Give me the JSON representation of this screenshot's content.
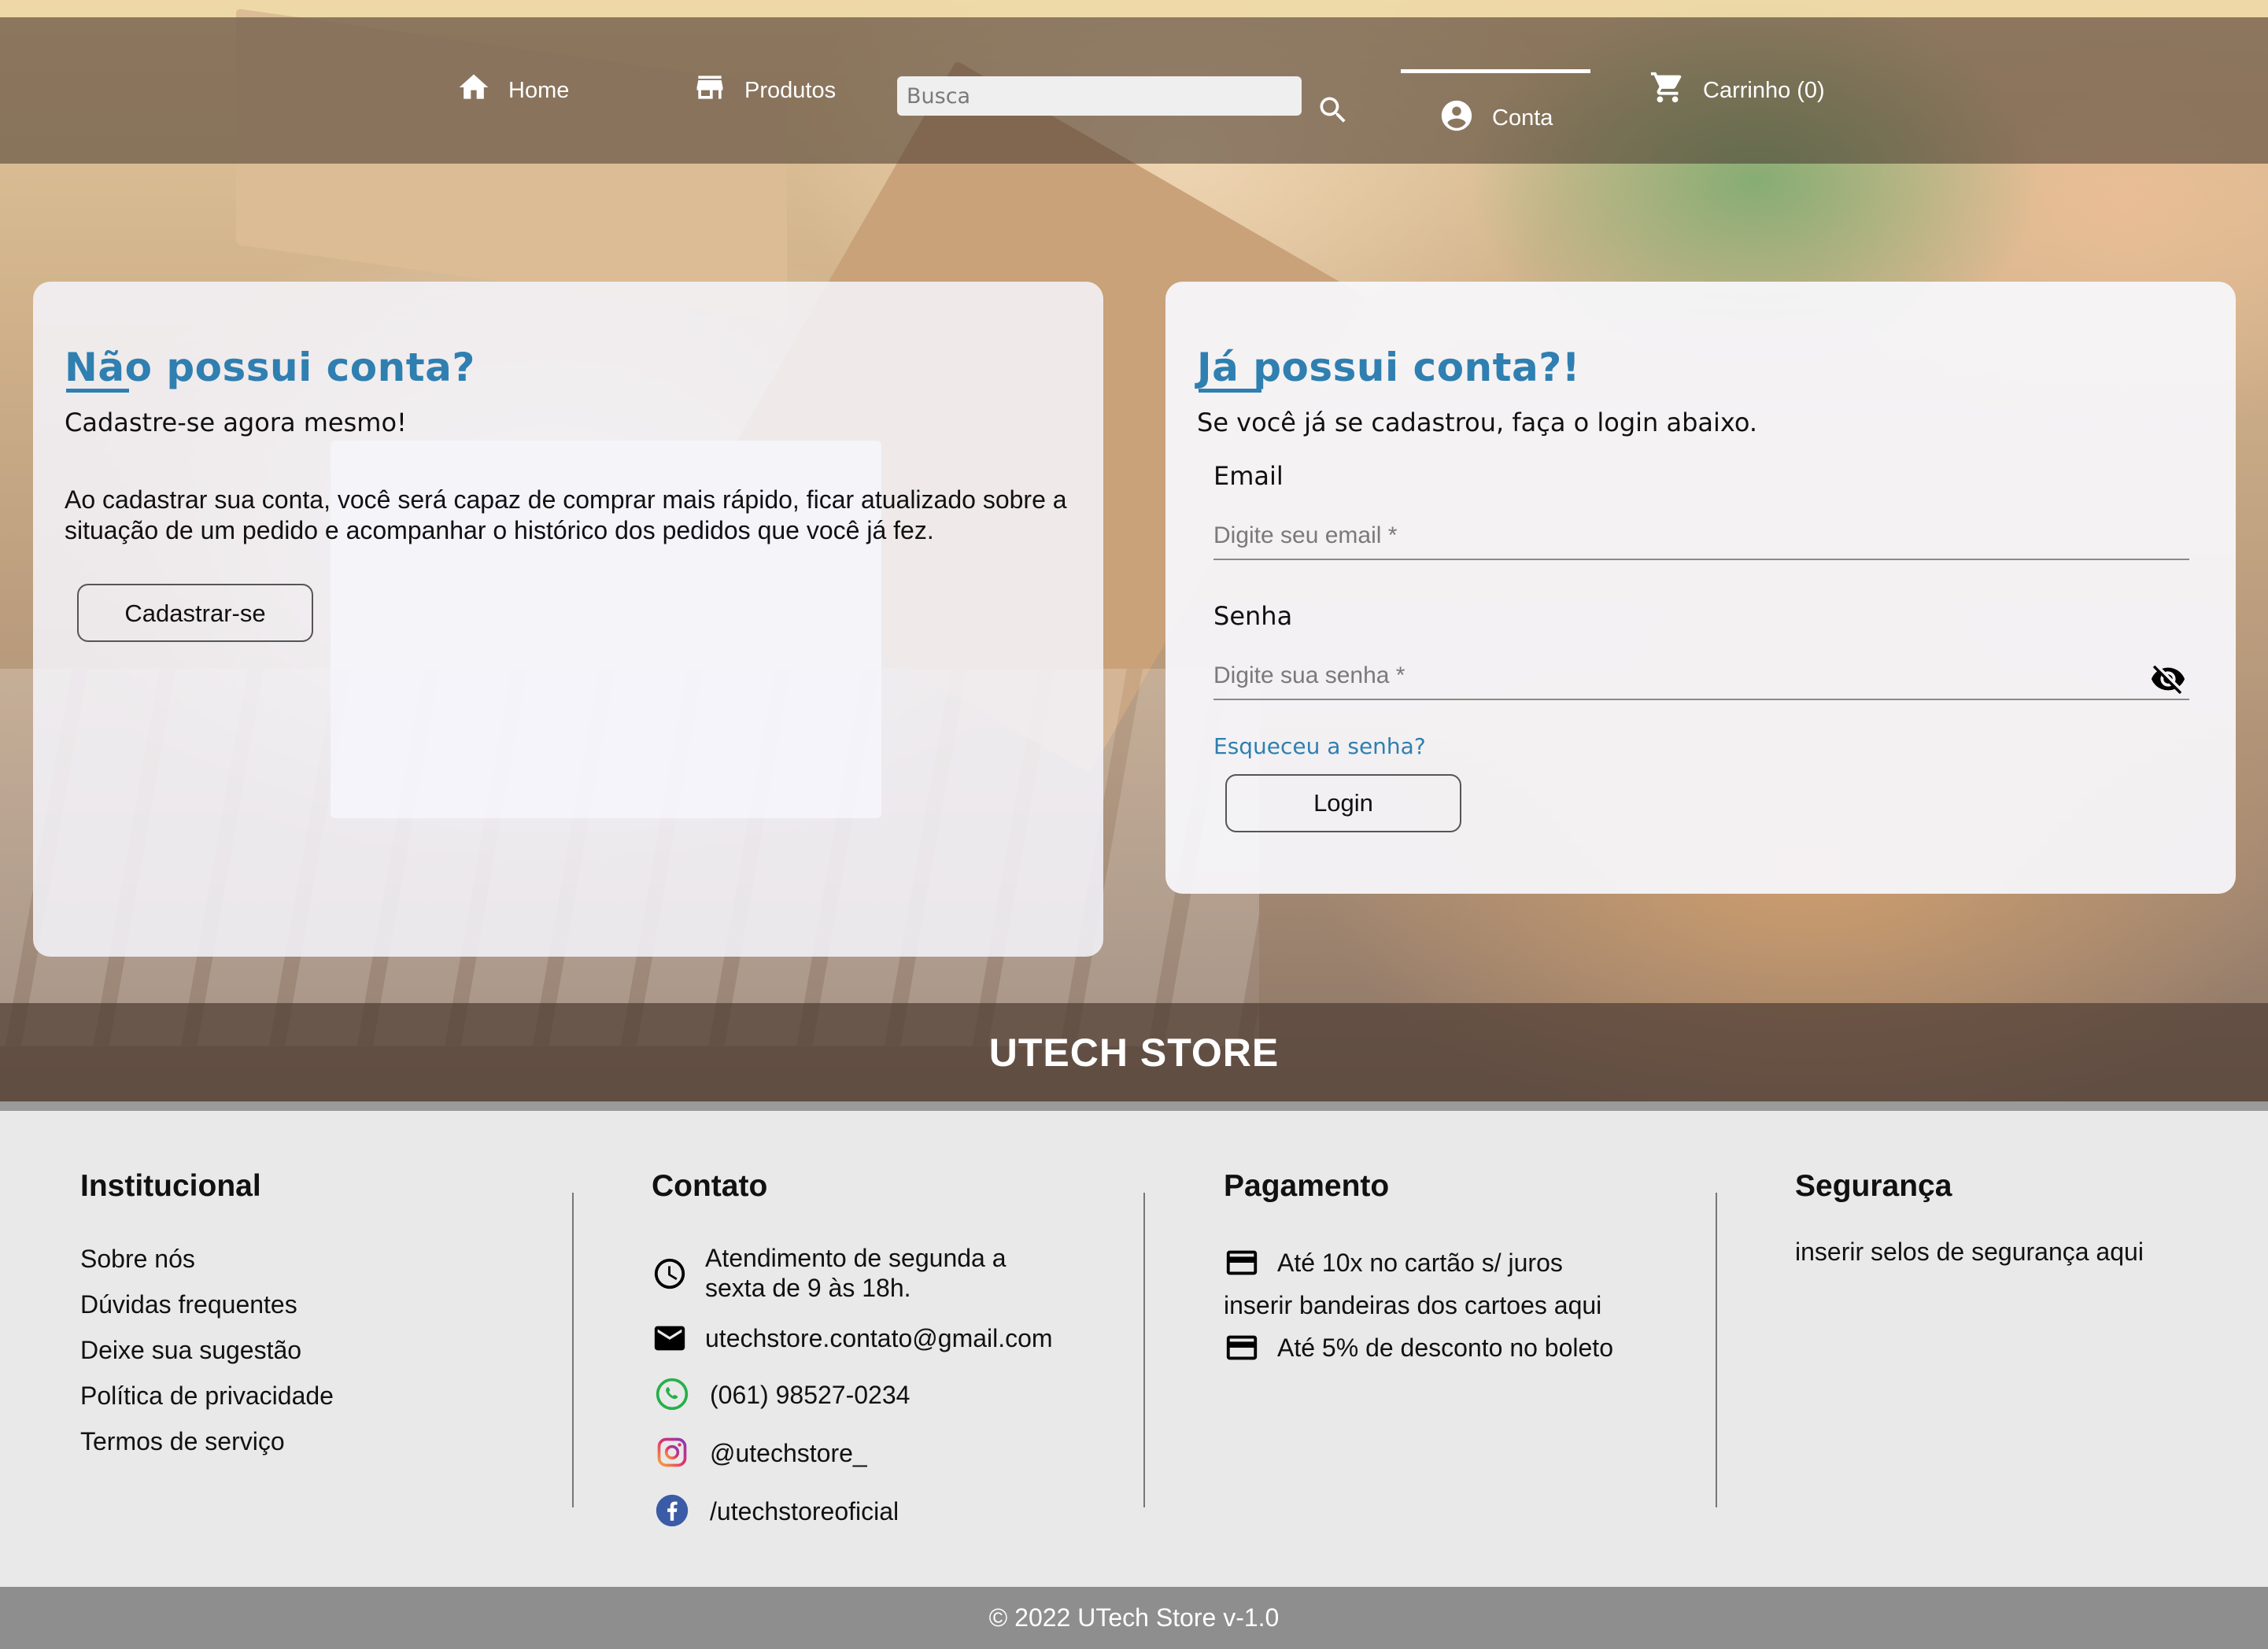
{
  "colors": {
    "accent": "#2f7fb1",
    "footer_bg": "#e9e9e9",
    "copyright_bg": "#8e8e8e"
  },
  "nav": {
    "home": "Home",
    "produtos": "Produtos",
    "search_placeholder": "Busca",
    "conta": "Conta",
    "carrinho": "Carrinho (0)"
  },
  "register": {
    "title": "Não possui conta?",
    "subtitle": "Cadastre-se agora mesmo!",
    "description": "Ao cadastrar sua conta, você será capaz de comprar mais rápido, ficar atualizado sobre a situação de um pedido e acompanhar o histórico dos pedidos que você já fez.",
    "button": "Cadastrar-se"
  },
  "login": {
    "title": "Já possui conta?!",
    "subtitle": "Se você já se cadastrou, faça o login abaixo.",
    "email_label": "Email",
    "email_placeholder": "Digite seu email *",
    "password_label": "Senha",
    "password_placeholder": "Digite sua senha *",
    "forgot": "Esqueceu a senha?",
    "button": "Login"
  },
  "brand": "UTECH STORE",
  "footer": {
    "institucional": {
      "title": "Institucional",
      "links": [
        "Sobre nós",
        "Dúvidas frequentes",
        "Deixe sua sugestão",
        "Política de privacidade",
        "Termos de serviço"
      ]
    },
    "contato": {
      "title": "Contato",
      "hours_line1": "Atendimento de segunda a",
      "hours_line2": "sexta de 9 às 18h.",
      "email": "utechstore.contato@gmail.com",
      "phone": "(061) 98527-0234",
      "instagram": "@utechstore_",
      "facebook": "/utechstoreoficial"
    },
    "pagamento": {
      "title": "Pagamento",
      "card": "Até 10x no cartão s/ juros",
      "brands": "inserir bandeiras dos cartoes aqui",
      "boleto": "Até 5% de desconto no boleto"
    },
    "seguranca": {
      "title": "Segurança",
      "text": "inserir selos de segurança aqui"
    }
  },
  "copyright": "© 2022 UTech Store v-1.0",
  "icons": [
    "home-icon",
    "store-icon",
    "search-icon",
    "account-circle-icon",
    "cart-icon",
    "eye-off-icon",
    "clock-icon",
    "mail-icon",
    "whatsapp-icon",
    "instagram-icon",
    "facebook-icon",
    "credit-card-icon"
  ]
}
